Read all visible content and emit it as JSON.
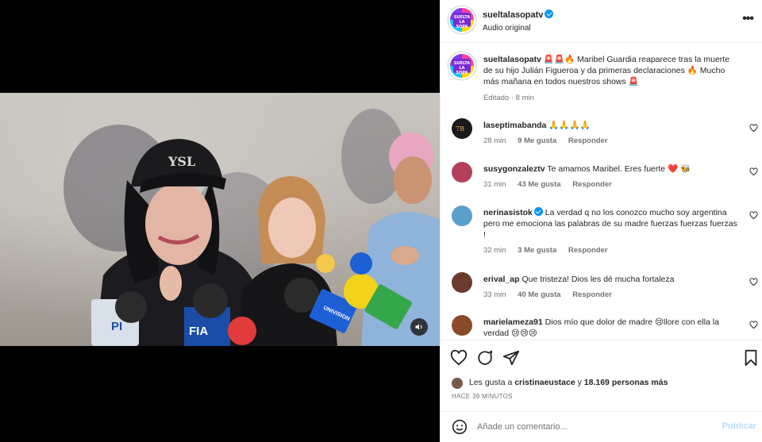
{
  "post": {
    "username": "sueltalasopatv",
    "audio": "Audio original",
    "brand_avatar_text": "SUELTA LA SOPA",
    "caption_emojis": "🚨🚨🔥",
    "caption_text": "Maribel Guardia reaparece tras la muerte de su hijo Julián Figueroa y da primeras declaraciones 🔥 Mucho más mañana en todos nuestros shows 🚨",
    "edited": "Editado · 8 min",
    "more_icon": "more-options-icon"
  },
  "comments": [
    {
      "user": "laseptimabanda",
      "verified": false,
      "text": "🙏🙏🙏🙏",
      "time": "28 min",
      "likes": "9 Me gusta",
      "reply": "Responder",
      "avatar_color": "#1a1a1a"
    },
    {
      "user": "susygonzaleztv",
      "verified": false,
      "text": "Te amamos Maribel. Eres fuerte ❤️ 🐝",
      "time": "31 min",
      "likes": "43 Me gusta",
      "reply": "Responder",
      "avatar_color": "#b3405a"
    },
    {
      "user": "nerinasistok",
      "verified": true,
      "text": "La verdad q no los conozco mucho soy argentina pero me emociona las palabras de su madre fuerzas fuerzas fuerzas !",
      "time": "32 min",
      "likes": "3 Me gusta",
      "reply": "Responder",
      "avatar_color": "#5aa0c8"
    },
    {
      "user": "erival_ap",
      "verified": false,
      "text": "Que tristeza! Dios les dé mucha fortaleza",
      "time": "33 min",
      "likes": "40 Me gusta",
      "reply": "Responder",
      "avatar_color": "#6b3b2e"
    },
    {
      "user": "marielameza91",
      "verified": false,
      "text": "Dios mío que dolor de madre 😢llore con ella la verdad 😢😢😢",
      "time": "",
      "likes": "",
      "reply": "",
      "avatar_color": "#8a4a2a"
    }
  ],
  "actions": {
    "like_icon": "heart-icon",
    "comment_icon": "comment-icon",
    "share_icon": "share-icon",
    "save_icon": "bookmark-icon"
  },
  "likes": {
    "prefix": "Les gusta a",
    "user": "cristinaeustace",
    "and": "y",
    "others": "18.169 personas más",
    "ago": "HACE 39 MINUTOS"
  },
  "composer": {
    "placeholder": "Añade un comentario...",
    "publish": "Publicar",
    "emoji_icon": "emoji-icon"
  },
  "video": {
    "mute_icon": "speaker-icon",
    "mic_brand_1": "FIA",
    "mic_brand_2": "PI",
    "mic_brand_3": "UNIVISION"
  },
  "colors": {
    "accent": "#0095f6",
    "publish_disabled": "#b2dffc",
    "heart_red": "#ed4956"
  }
}
